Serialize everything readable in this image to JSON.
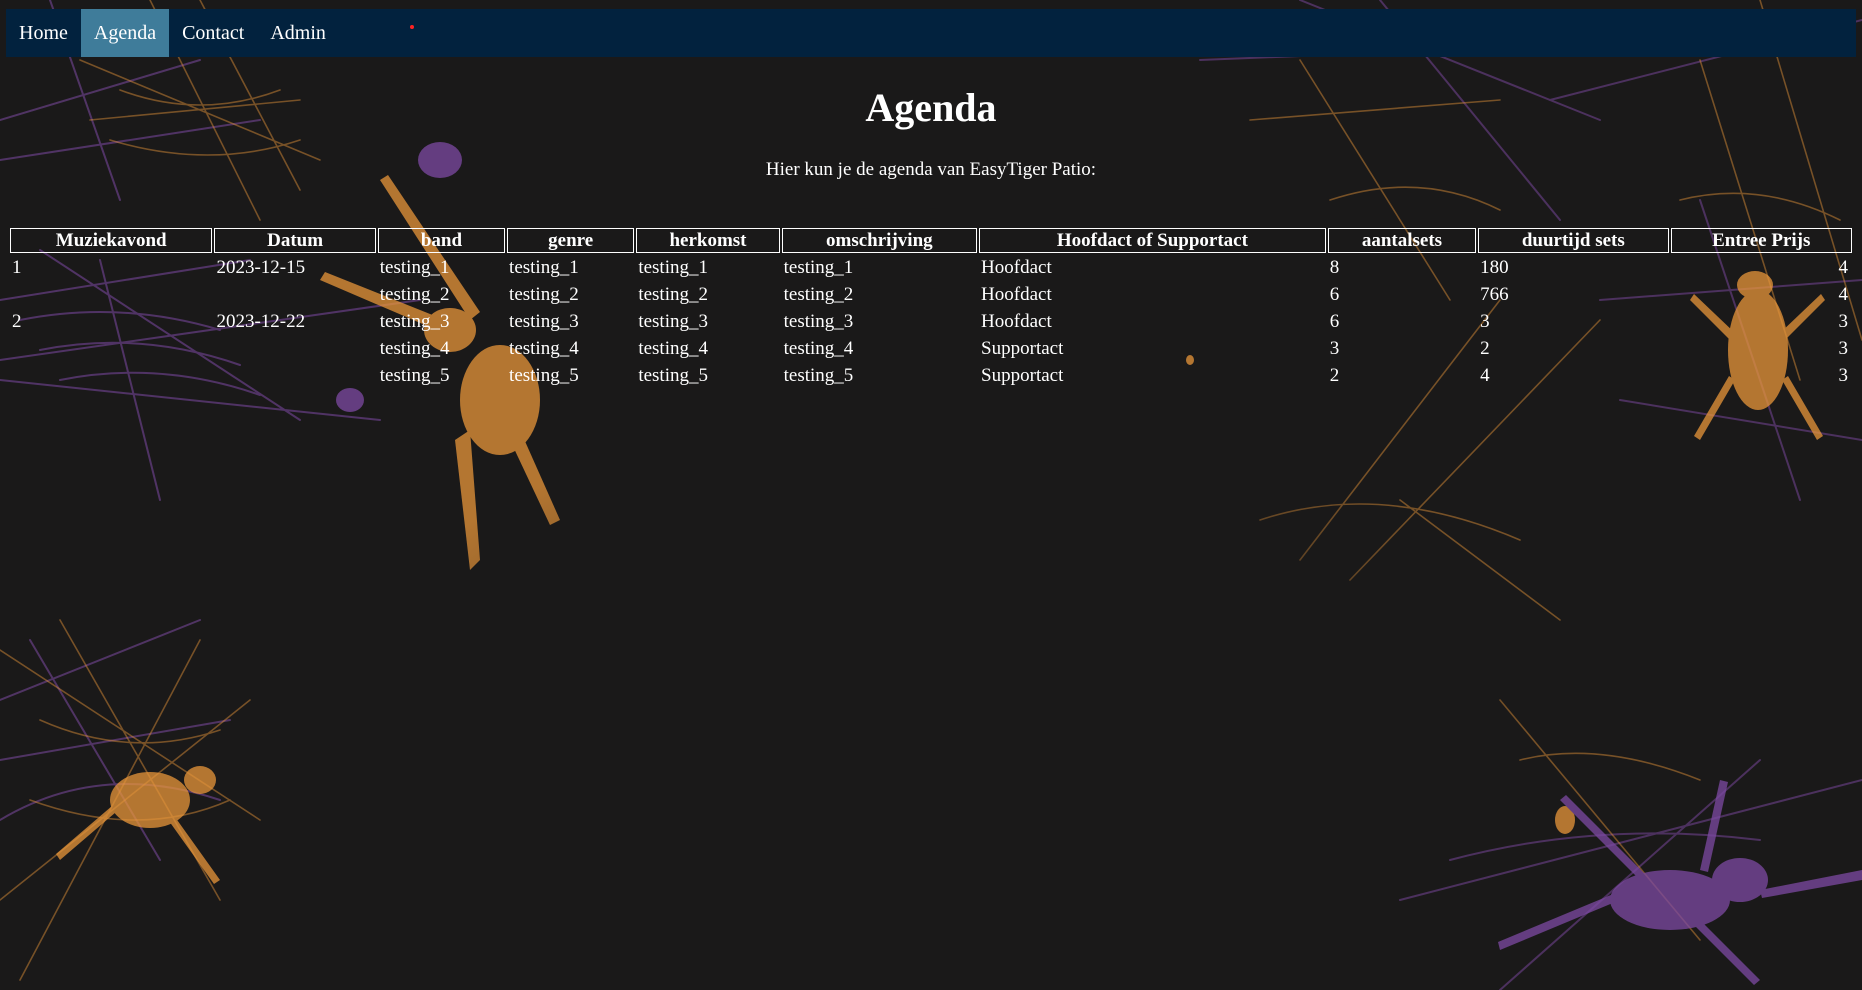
{
  "nav": {
    "items": [
      {
        "label": "Home",
        "active": false
      },
      {
        "label": "Agenda",
        "active": true
      },
      {
        "label": "Contact",
        "active": false
      },
      {
        "label": "Admin",
        "active": false
      }
    ]
  },
  "page": {
    "title": "Agenda",
    "intro": "Hier kun je de agenda van EasyTiger Patio:"
  },
  "table": {
    "headers": [
      "Muziekavond",
      "Datum",
      "band",
      "genre",
      "herkomst",
      "omschrijving",
      "Hoofdact of Supportact",
      "aantalsets",
      "duurtijd sets",
      "Entree Prijs"
    ],
    "rows": [
      {
        "muziekavond": "1",
        "datum": "2023-12-15",
        "band": "testing_1",
        "genre": "testing_1",
        "herkomst": "testing_1",
        "omschrijving": "testing_1",
        "act": "Hoofdact",
        "aantalsets": "8",
        "duurtijd": "180",
        "prijs": "4"
      },
      {
        "muziekavond": "",
        "datum": "",
        "band": "testing_2",
        "genre": "testing_2",
        "herkomst": "testing_2",
        "omschrijving": "testing_2",
        "act": "Hoofdact",
        "aantalsets": "6",
        "duurtijd": "766",
        "prijs": "4"
      },
      {
        "muziekavond": "2",
        "datum": "2023-12-22",
        "band": "testing_3",
        "genre": "testing_3",
        "herkomst": "testing_3",
        "omschrijving": "testing_3",
        "act": "Hoofdact",
        "aantalsets": "6",
        "duurtijd": "3",
        "prijs": "3"
      },
      {
        "muziekavond": "",
        "datum": "",
        "band": "testing_4",
        "genre": "testing_4",
        "herkomst": "testing_4",
        "omschrijving": "testing_4",
        "act": "Supportact",
        "aantalsets": "3",
        "duurtijd": "2",
        "prijs": "3"
      },
      {
        "muziekavond": "",
        "datum": "",
        "band": "testing_5",
        "genre": "testing_5",
        "herkomst": "testing_5",
        "omschrijving": "testing_5",
        "act": "Supportact",
        "aantalsets": "2",
        "duurtijd": "4",
        "prijs": "3"
      }
    ]
  },
  "colors": {
    "background": "#1a1919",
    "nav_background": "#02223e",
    "nav_active": "#3f7c9a",
    "text": "#ffffff",
    "web_orange": "#e8963a",
    "web_purple": "#7d4aa3"
  },
  "icons": {
    "background_art": "spider-web-background"
  }
}
